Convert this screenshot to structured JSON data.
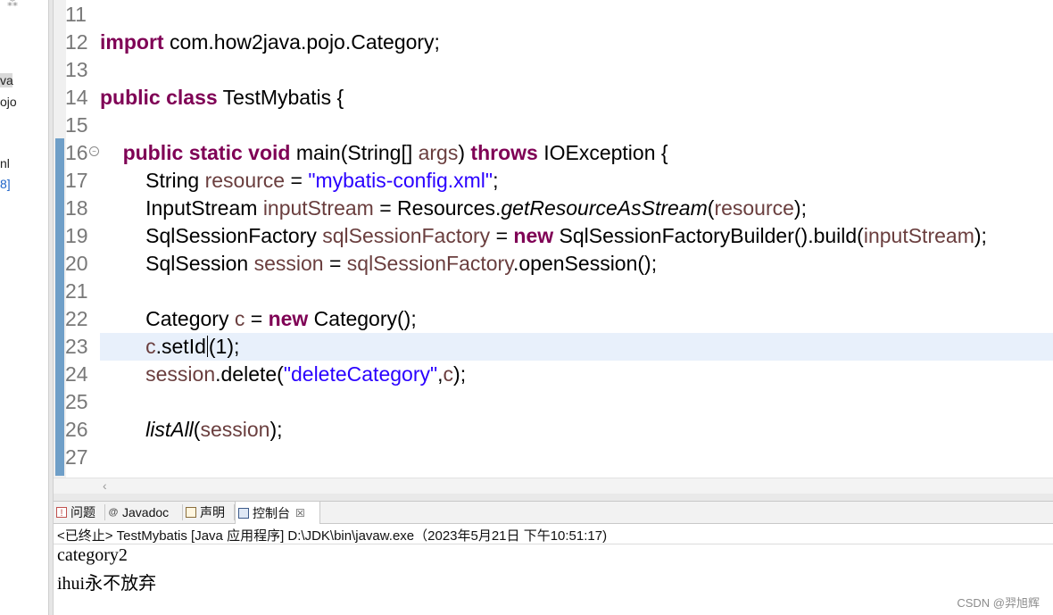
{
  "left_panel": {
    "fragments": [
      {
        "text": "va",
        "selected": true
      },
      {
        "text": "ojo",
        "selected": false
      },
      {
        "text": "nl",
        "selected": false
      },
      {
        "text": "8]",
        "selected": false,
        "blue": true
      }
    ]
  },
  "editor": {
    "lines": [
      {
        "num": "11",
        "segments": []
      },
      {
        "num": "12",
        "segments": [
          {
            "t": "import",
            "c": "kw"
          },
          {
            "t": " com.how2java.pojo.Category;"
          }
        ]
      },
      {
        "num": "13",
        "segments": []
      },
      {
        "num": "14",
        "segments": [
          {
            "t": "public",
            "c": "kw"
          },
          {
            "t": " "
          },
          {
            "t": "class",
            "c": "kw"
          },
          {
            "t": " TestMybatis {"
          }
        ]
      },
      {
        "num": "15",
        "segments": []
      },
      {
        "num": "16",
        "fold": true,
        "segments": [
          {
            "t": "    "
          },
          {
            "t": "public",
            "c": "kw"
          },
          {
            "t": " "
          },
          {
            "t": "static",
            "c": "kw"
          },
          {
            "t": " "
          },
          {
            "t": "void",
            "c": "kw"
          },
          {
            "t": " main(String[] "
          },
          {
            "t": "args",
            "c": "var"
          },
          {
            "t": ") "
          },
          {
            "t": "throws",
            "c": "kw"
          },
          {
            "t": " IOException {"
          }
        ]
      },
      {
        "num": "17",
        "segments": [
          {
            "t": "        String "
          },
          {
            "t": "resource",
            "c": "var"
          },
          {
            "t": " = "
          },
          {
            "t": "\"mybatis-config.xml\"",
            "c": "str"
          },
          {
            "t": ";"
          }
        ]
      },
      {
        "num": "18",
        "segments": [
          {
            "t": "        InputStream "
          },
          {
            "t": "inputStream",
            "c": "var"
          },
          {
            "t": " = Resources."
          },
          {
            "t": "getResourceAsStream",
            "c": "it"
          },
          {
            "t": "("
          },
          {
            "t": "resource",
            "c": "var"
          },
          {
            "t": ");"
          }
        ]
      },
      {
        "num": "19",
        "segments": [
          {
            "t": "        SqlSessionFactory "
          },
          {
            "t": "sqlSessionFactory",
            "c": "var"
          },
          {
            "t": " = "
          },
          {
            "t": "new",
            "c": "kw"
          },
          {
            "t": " SqlSessionFactoryBuilder().build("
          },
          {
            "t": "inputStream",
            "c": "var"
          },
          {
            "t": ");"
          }
        ]
      },
      {
        "num": "20",
        "segments": [
          {
            "t": "        SqlSession "
          },
          {
            "t": "session",
            "c": "var"
          },
          {
            "t": " = "
          },
          {
            "t": "sqlSessionFactory",
            "c": "var"
          },
          {
            "t": ".openSession();"
          }
        ]
      },
      {
        "num": "21",
        "segments": []
      },
      {
        "num": "22",
        "segments": [
          {
            "t": "        Category "
          },
          {
            "t": "c",
            "c": "var"
          },
          {
            "t": " = "
          },
          {
            "t": "new",
            "c": "kw"
          },
          {
            "t": " Category();"
          }
        ]
      },
      {
        "num": "23",
        "current": true,
        "segments": [
          {
            "t": "        "
          },
          {
            "t": "c",
            "c": "var"
          },
          {
            "t": ".setId"
          },
          {
            "caret": true
          },
          {
            "t": "(1);"
          }
        ]
      },
      {
        "num": "24",
        "segments": [
          {
            "t": "        "
          },
          {
            "t": "session",
            "c": "var"
          },
          {
            "t": ".delete("
          },
          {
            "t": "\"deleteCategory\"",
            "c": "str"
          },
          {
            "t": ","
          },
          {
            "t": "c",
            "c": "var"
          },
          {
            "t": ");"
          }
        ]
      },
      {
        "num": "25",
        "segments": []
      },
      {
        "num": "26",
        "segments": [
          {
            "t": "        "
          },
          {
            "t": "listAll",
            "c": "it"
          },
          {
            "t": "("
          },
          {
            "t": "session",
            "c": "var"
          },
          {
            "t": ");"
          }
        ]
      },
      {
        "num": "27",
        "segments": []
      }
    ]
  },
  "tabs": [
    {
      "label": "问题",
      "icon": "problems-icon",
      "glyph": "!"
    },
    {
      "label": "Javadoc",
      "icon": "javadoc-icon",
      "glyph": "@"
    },
    {
      "label": "声明",
      "icon": "declaration-icon",
      "glyph": ""
    },
    {
      "label": "控制台",
      "icon": "console-icon",
      "glyph": "",
      "active": true,
      "close": "☒"
    }
  ],
  "console": {
    "status": "<已终止> TestMybatis [Java 应用程序] D:\\JDK\\bin\\javaw.exe（2023年5月21日 下午10:51:17)",
    "output": [
      "category2",
      "ihui永不放弃"
    ]
  },
  "watermark": "CSDN @羿旭辉"
}
